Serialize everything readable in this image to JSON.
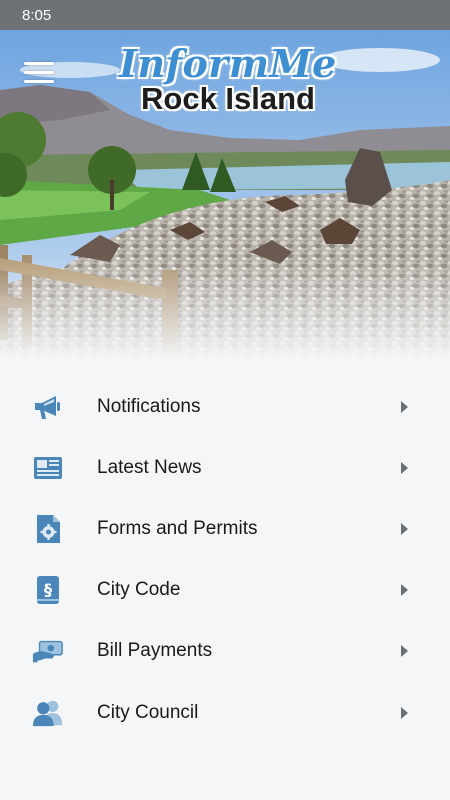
{
  "status_bar": {
    "time": "8:05"
  },
  "header": {
    "logo_script": "InformMe",
    "logo_main": "Rock Island",
    "menu_icon": "hamburger-menu-icon"
  },
  "menu": {
    "items": [
      {
        "label": "Notifications",
        "icon": "megaphone-icon"
      },
      {
        "label": "Latest News",
        "icon": "newspaper-icon"
      },
      {
        "label": "Forms and Permits",
        "icon": "document-gear-icon"
      },
      {
        "label": "City Code",
        "icon": "code-book-icon"
      },
      {
        "label": "Bill Payments",
        "icon": "bill-payment-icon"
      },
      {
        "label": "City Council",
        "icon": "council-people-icon"
      }
    ]
  },
  "colors": {
    "accent": "#3d8fd1",
    "icon": "#4a86b8",
    "background": "#f4f6f8",
    "status_bar": "#6e7175"
  }
}
